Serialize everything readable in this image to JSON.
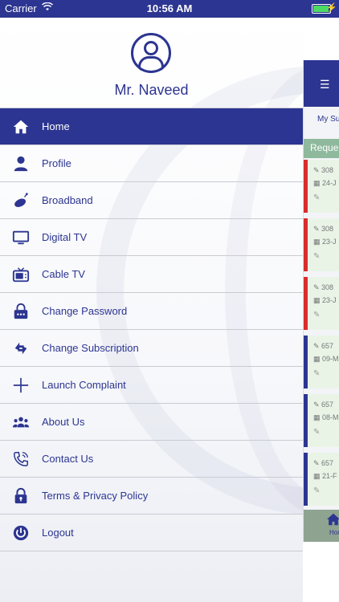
{
  "status_bar": {
    "carrier": "Carrier",
    "time": "10:56 AM"
  },
  "profile": {
    "name": "Mr. Naveed"
  },
  "menu": {
    "items": [
      {
        "label": "Home",
        "icon": "home-icon",
        "active": true
      },
      {
        "label": "Profile",
        "icon": "user-icon"
      },
      {
        "label": "Broadband",
        "icon": "broadband-icon"
      },
      {
        "label": "Digital TV",
        "icon": "monitor-icon"
      },
      {
        "label": "Cable TV",
        "icon": "tv-icon"
      },
      {
        "label": "Change Password",
        "icon": "lock-dots-icon"
      },
      {
        "label": "Change Subscription",
        "icon": "swap-arrows-icon"
      },
      {
        "label": "Launch Complaint",
        "icon": "plus-icon"
      },
      {
        "label": "About Us",
        "icon": "group-icon"
      },
      {
        "label": "Contact Us",
        "icon": "phone-icon"
      },
      {
        "label": "Terms & Privacy Policy",
        "icon": "padlock-icon"
      },
      {
        "label": "Logout",
        "icon": "power-icon"
      }
    ]
  },
  "peek": {
    "menu_glyph": "☰",
    "subtitle": "My Su",
    "requests_label": "Reque",
    "cards": [
      {
        "id": "308",
        "date": "24-J",
        "status": "red"
      },
      {
        "id": "308",
        "date": "23-J",
        "status": "red"
      },
      {
        "id": "308",
        "date": "23-J",
        "status": "red"
      },
      {
        "id": "657",
        "date": "09-M",
        "status": "blue"
      },
      {
        "id": "657",
        "date": "08-M",
        "status": "blue"
      },
      {
        "id": "657",
        "date": "21-F",
        "status": "blue"
      }
    ],
    "home_label": "Hon"
  },
  "colors": {
    "primary": "#2c3591",
    "card_bg": "#e9f4e7",
    "red_status": "#d92d2d",
    "requests_bar": "#8fb99c"
  }
}
